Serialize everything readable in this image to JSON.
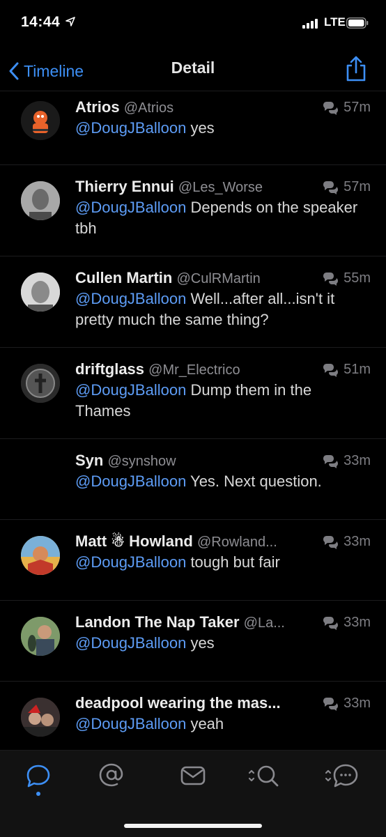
{
  "status": {
    "time": "14:44",
    "network": "LTE"
  },
  "nav": {
    "back_label": "Timeline",
    "title": "Detail"
  },
  "tweets": [
    {
      "name": "Atrios",
      "handle": "@Atrios",
      "time": "57m",
      "mention": "@DougJBalloon",
      "text": " yes"
    },
    {
      "name": "Thierry Ennui",
      "handle": "@Les_Worse",
      "time": "57m",
      "mention": "@DougJBalloon",
      "text": " Depends on the speaker tbh"
    },
    {
      "name": "Cullen Martin",
      "handle": "@CulRMartin",
      "time": "55m",
      "mention": "@DougJBalloon",
      "text": " Well...after all...isn't it pretty much the same thing?"
    },
    {
      "name": "driftglass",
      "handle": "@Mr_Electrico",
      "time": "51m",
      "mention": "@DougJBalloon",
      "text": " Dump them in the Thames"
    },
    {
      "name": "Syn",
      "handle": "@synshow",
      "time": "33m",
      "mention": "@DougJBalloon",
      "text": " Yes. Next question."
    },
    {
      "name": "Matt ☃ Howland",
      "handle": "@Rowland...",
      "time": "33m",
      "mention": "@DougJBalloon",
      "text": " tough but fair"
    },
    {
      "name": "Landon The Nap Taker",
      "handle": "@La...",
      "time": "33m",
      "mention": "@DougJBalloon",
      "text": " yes"
    },
    {
      "name": "deadpool wearing the mas...",
      "handle": "",
      "time": "33m",
      "mention": "@DougJBalloon",
      "text": " yeah"
    }
  ],
  "tabs": [
    {
      "icon": "conversation-icon",
      "active": true
    },
    {
      "icon": "mentions-icon",
      "active": false
    },
    {
      "icon": "messages-icon",
      "active": false
    },
    {
      "icon": "search-icon",
      "active": false
    },
    {
      "icon": "lists-icon",
      "active": false
    }
  ],
  "colors": {
    "accent": "#3d8ff5",
    "mention": "#5d9cf5",
    "background": "#000000"
  }
}
